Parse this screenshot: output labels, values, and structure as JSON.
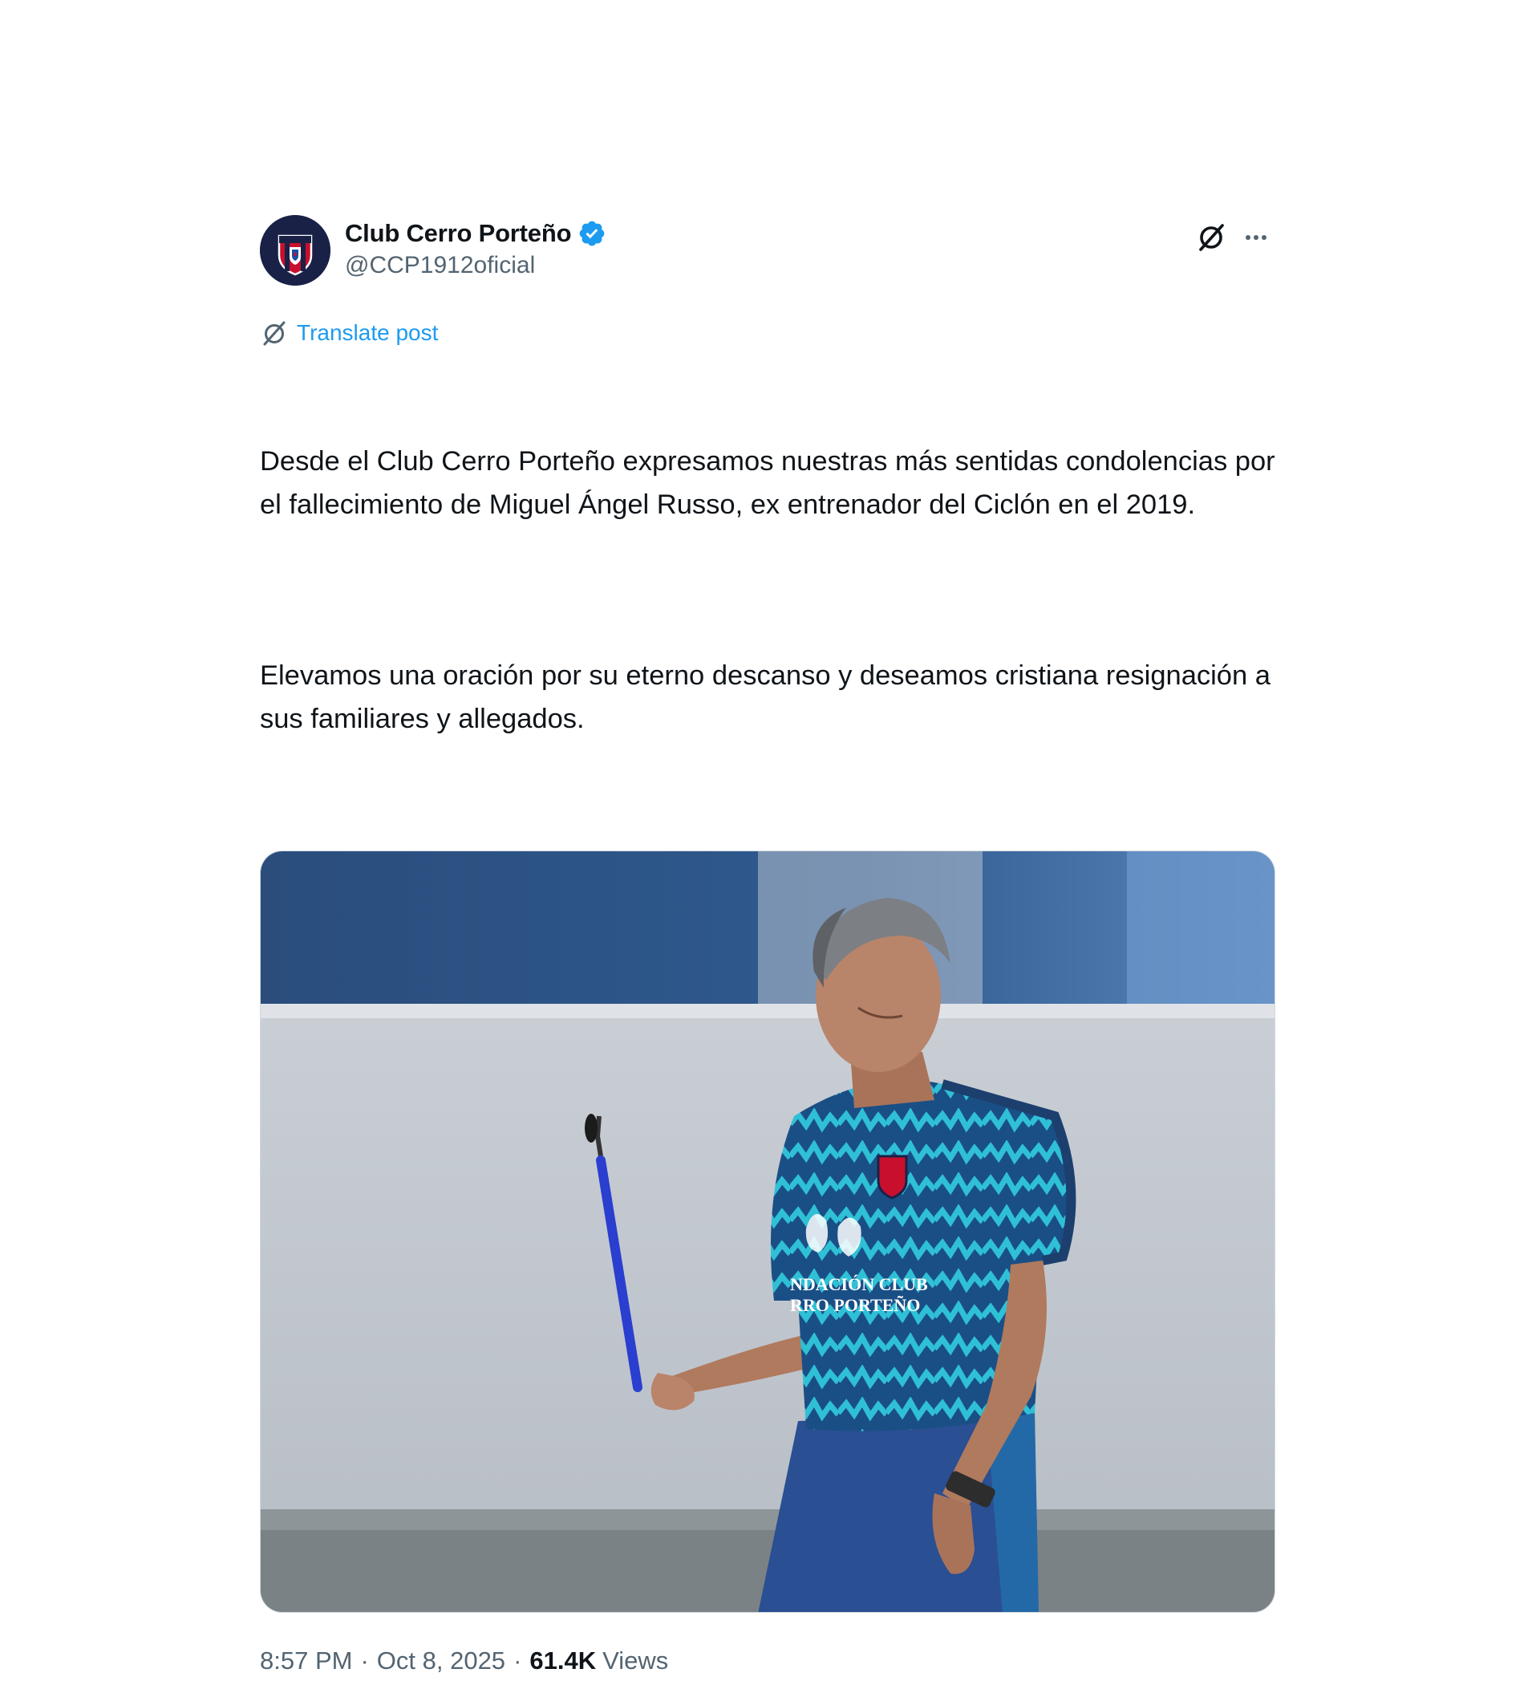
{
  "account": {
    "display_name": "Club Cerro Porteño",
    "handle": "@CCP1912oficial",
    "verified": true,
    "verified_color": "#1d9bf0"
  },
  "actions": {
    "grok_icon": "grok-icon",
    "more_icon": "more-icon"
  },
  "translate": {
    "label": "Translate post",
    "icon": "translate-icon"
  },
  "post": {
    "paragraph_1": "Desde el Club Cerro Porteño expresamos nuestras más sentidas condolencias por el fallecimiento de Miguel Ángel Russo, ex entrenador del Ciclón en el 2019.",
    "paragraph_2": "Elevamos una oración por su eterno descanso y deseamos cristiana resignación a sus familiares y allegados."
  },
  "media": {
    "shirt_text_line_1": "NDACIÓN CLUB",
    "shirt_text_line_2": "RRO PORTEÑO"
  },
  "meta": {
    "time": "8:57 PM",
    "separator": "·",
    "date": "Oct 8, 2025",
    "views_count": "61.4K",
    "views_label": "Views"
  },
  "colors": {
    "link_blue": "#1d9bf0",
    "secondary_text": "#536471",
    "primary_text": "#0f1419",
    "club_blue": "#1a2147",
    "club_red": "#c8102e"
  }
}
